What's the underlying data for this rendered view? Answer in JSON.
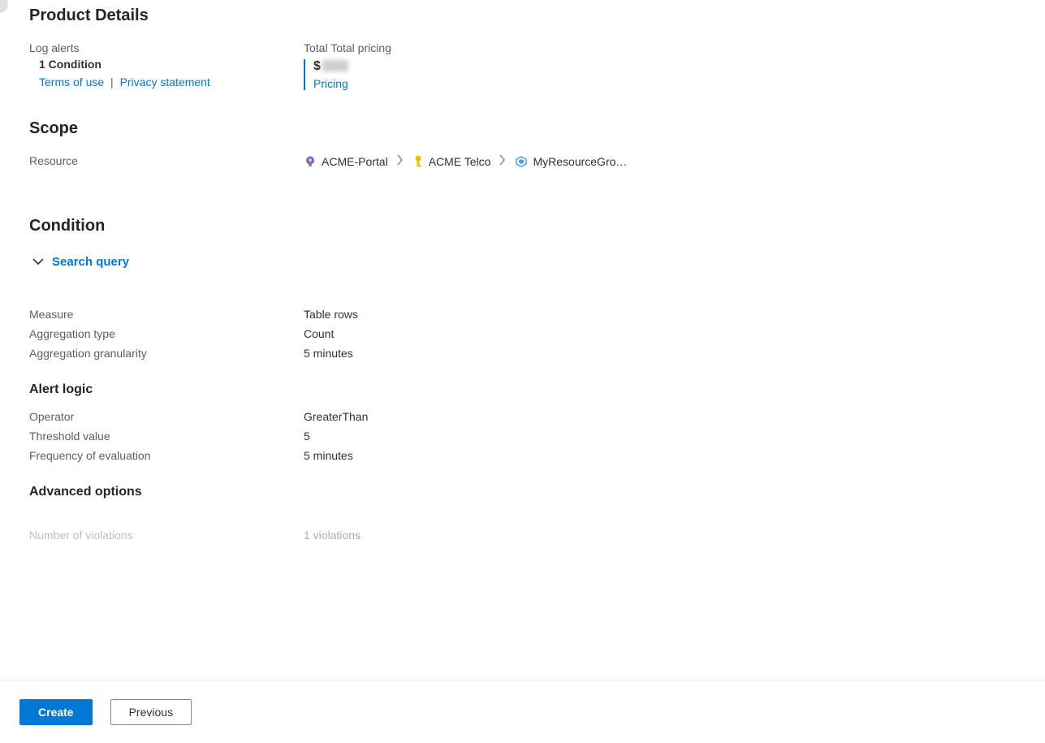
{
  "product": {
    "heading": "Product Details",
    "left_label": "Log alerts",
    "condition_count": "1 Condition",
    "terms_link": "Terms of use",
    "privacy_link": "Privacy statement",
    "pricing_header": "Total Total pricing",
    "price_prefix": "$",
    "pricing_link": "Pricing"
  },
  "scope": {
    "heading": "Scope",
    "label": "Resource",
    "breadcrumb": [
      {
        "label": "ACME-Portal"
      },
      {
        "label": "ACME Telco"
      },
      {
        "label": "MyResourceGro…"
      }
    ]
  },
  "condition": {
    "heading": "Condition",
    "search_query_label": "Search query",
    "measure": {
      "key": "Measure",
      "val": "Table rows"
    },
    "agg_type": {
      "key": "Aggregation type",
      "val": "Count"
    },
    "agg_gran": {
      "key": "Aggregation granularity",
      "val": "5 minutes"
    },
    "alert_logic_heading": "Alert logic",
    "operator": {
      "key": "Operator",
      "val": "GreaterThan"
    },
    "threshold": {
      "key": "Threshold value",
      "val": "5"
    },
    "frequency": {
      "key": "Frequency of evaluation",
      "val": "5 minutes"
    },
    "advanced_heading": "Advanced options",
    "violations": {
      "key": "Number of violations",
      "val": "1 violations"
    }
  },
  "footer": {
    "create": "Create",
    "previous": "Previous"
  }
}
